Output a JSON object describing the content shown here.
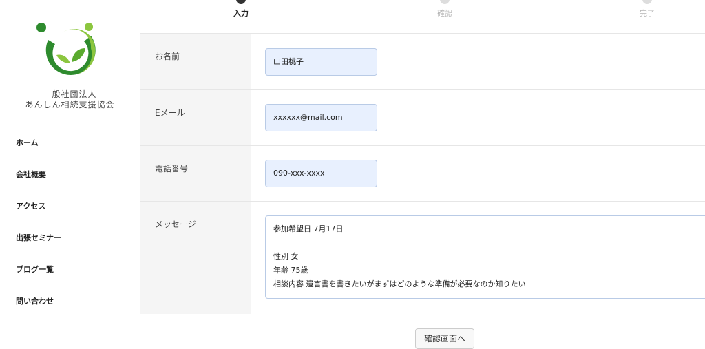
{
  "org": {
    "line1": "一般社団法人",
    "line2": "あんしん相続支援協会"
  },
  "nav": [
    "ホーム",
    "会社概要",
    "アクセス",
    "出張セミナー",
    "ブログ一覧",
    "問い合わせ"
  ],
  "steps": [
    {
      "label": "入力",
      "state": "active"
    },
    {
      "label": "確認",
      "state": "inactive"
    },
    {
      "label": "完了",
      "state": "inactive"
    }
  ],
  "fields": {
    "name": {
      "label": "お名前",
      "value": "山田桃子"
    },
    "email": {
      "label": "Eメール",
      "value": "xxxxxx@mail.com"
    },
    "phone": {
      "label": "電話番号",
      "value": "090-xxx-xxxx"
    },
    "message": {
      "label": "メッセージ",
      "lines": [
        "参加希望日 7月17日",
        "",
        "性別  女",
        "年齢  75歳",
        "相談内容  遺言書を書きたいがまずはどのような準備が必要なのか知りたい"
      ]
    }
  },
  "submit_label": "確認画面へ",
  "colors": {
    "logo_green_dark": "#2e8b2e",
    "logo_green_light": "#8cc63f",
    "input_bg": "#e8f0fe",
    "label_bg": "#f5f5f5"
  }
}
